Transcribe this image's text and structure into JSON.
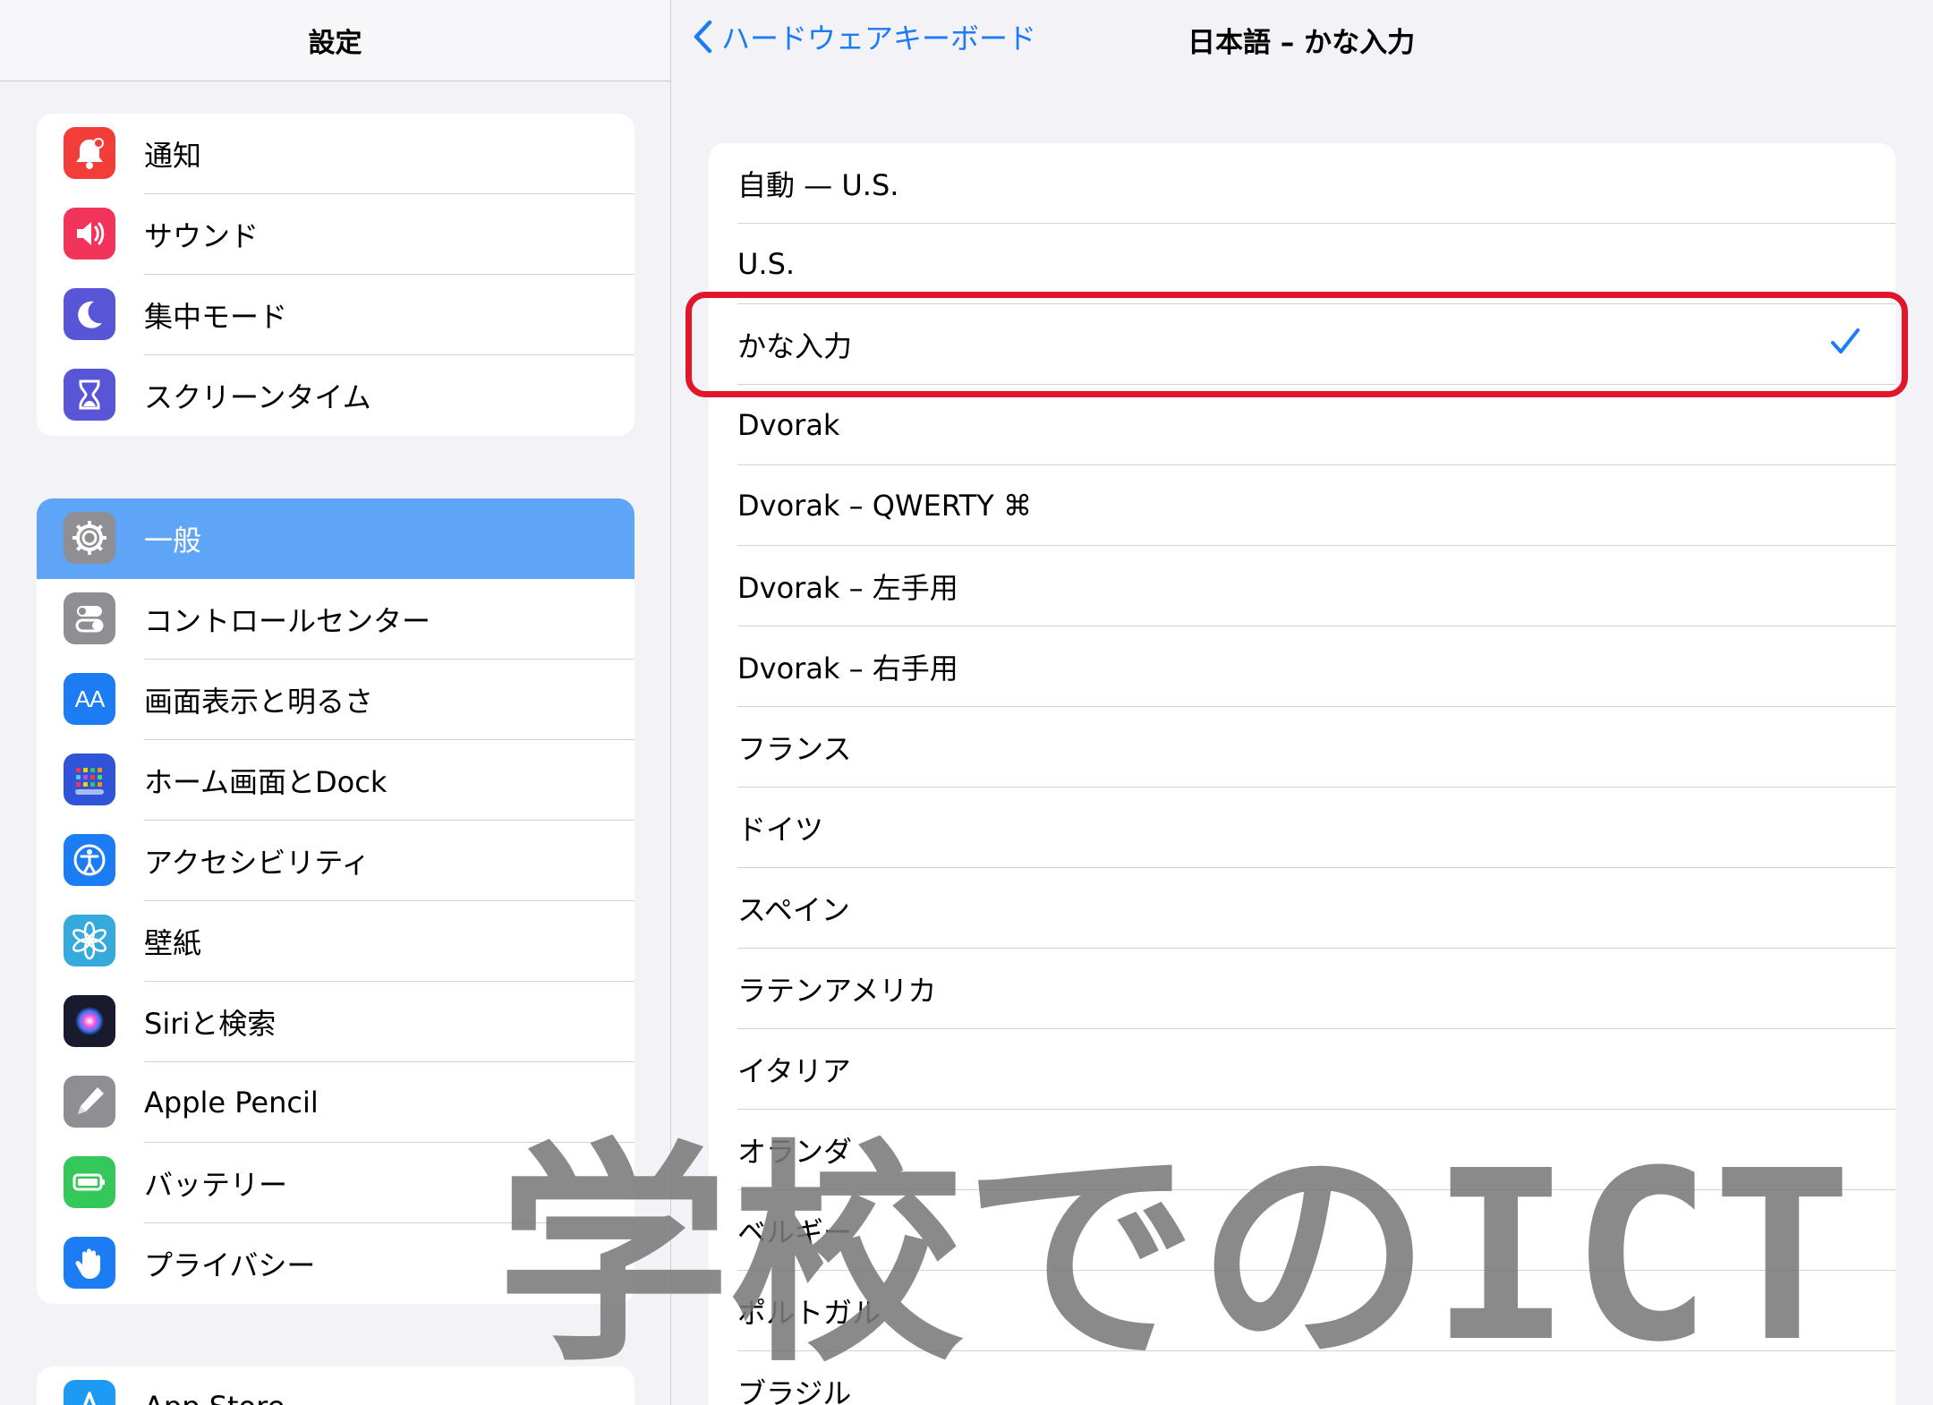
{
  "sidebar": {
    "title": "設定",
    "groups": [
      [
        {
          "label": "通知",
          "icon": "bell-icon",
          "color": "#f23d39"
        },
        {
          "label": "サウンド",
          "icon": "speaker-icon",
          "color": "#f2335a"
        },
        {
          "label": "集中モード",
          "icon": "moon-icon",
          "color": "#5856d6"
        },
        {
          "label": "スクリーンタイム",
          "icon": "hourglass-icon",
          "color": "#5856d6"
        }
      ],
      [
        {
          "label": "一般",
          "icon": "gear-icon",
          "color": "#8e8e93",
          "selected": true
        },
        {
          "label": "コントロールセンター",
          "icon": "toggles-icon",
          "color": "#8e8e93"
        },
        {
          "label": "画面表示と明るさ",
          "icon": "text-size-icon",
          "color": "#1c7cf4",
          "glyph": "AA"
        },
        {
          "label": "ホーム画面とDock",
          "icon": "home-grid-icon",
          "color": "#2f54d8"
        },
        {
          "label": "アクセシビリティ",
          "icon": "accessibility-icon",
          "color": "#1c7cf4"
        },
        {
          "label": "壁紙",
          "icon": "flower-icon",
          "color": "#36aadc"
        },
        {
          "label": "Siriと検索",
          "icon": "siri-icon",
          "color": "#1a1a2e"
        },
        {
          "label": "Apple Pencil",
          "icon": "pencil-icon",
          "color": "#8e8e93"
        },
        {
          "label": "バッテリー",
          "icon": "battery-icon",
          "color": "#34c759"
        },
        {
          "label": "プライバシー",
          "icon": "hand-icon",
          "color": "#1c7cf4"
        }
      ],
      [
        {
          "label": "App Store",
          "icon": "app-store-icon",
          "color": "#1c9af4"
        }
      ]
    ]
  },
  "detail": {
    "back_label": "ハードウェアキーボード",
    "title": "日本語 – かな入力",
    "options": [
      {
        "label": "自動 — U.S."
      },
      {
        "label": "U.S."
      },
      {
        "label": "かな入力",
        "selected": true
      },
      {
        "label": "Dvorak"
      },
      {
        "label": "Dvorak – QWERTY ⌘"
      },
      {
        "label": "Dvorak – 左手用"
      },
      {
        "label": "Dvorak – 右手用"
      },
      {
        "label": "フランス"
      },
      {
        "label": "ドイツ"
      },
      {
        "label": "スペイン"
      },
      {
        "label": "ラテンアメリカ"
      },
      {
        "label": "イタリア"
      },
      {
        "label": "オランダ"
      },
      {
        "label": "ベルギー"
      },
      {
        "label": "ポルトガル"
      },
      {
        "label": "ブラジル"
      }
    ]
  },
  "watermark": {
    "text": "学校でのICT",
    "color": "#7a7a7a"
  },
  "colors": {
    "accent": "#1c7cf4",
    "highlight": "#e0162b",
    "selected_row": "#5ea4f7"
  }
}
